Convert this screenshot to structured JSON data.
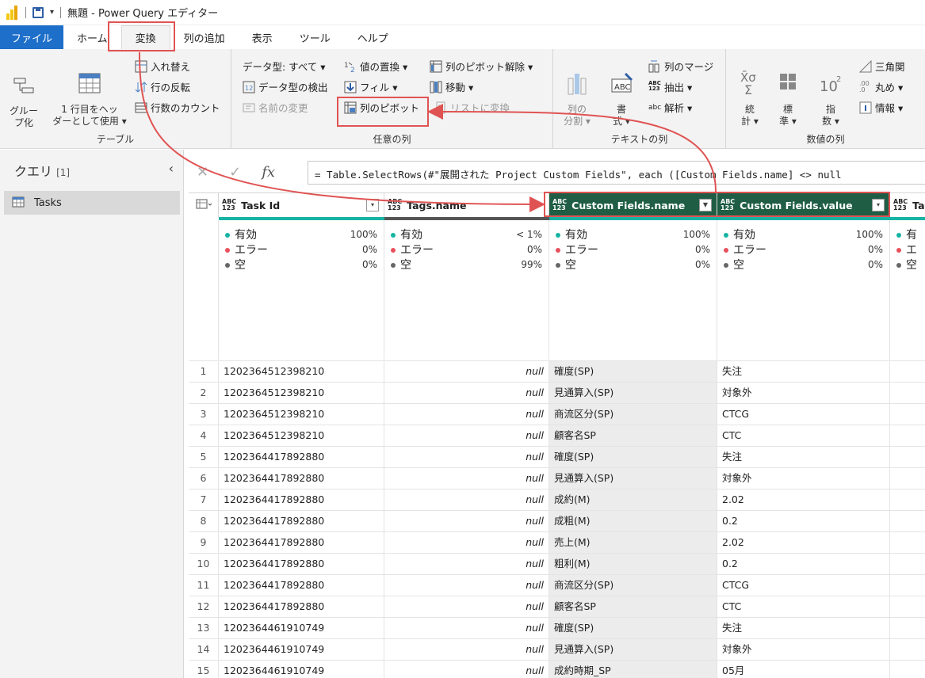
{
  "titlebar": {
    "qa_dropdown": "▾",
    "title": "無題 - Power Query エディター"
  },
  "tabs": [
    "ファイル",
    "ホーム",
    "変換",
    "列の追加",
    "表示",
    "ツール",
    "ヘルプ"
  ],
  "ribbon": {
    "table_group": {
      "label": "テーブル",
      "group_by": "グルー\nプ化",
      "first_row": "1 行目をヘッ\nダーとして使用 ▾",
      "transpose": "入れ替え",
      "reverse_rows": "行の反転",
      "count_rows": "行数のカウント"
    },
    "any_column_group": {
      "label": "任意の列",
      "data_type": "データ型: すべて ▾",
      "detect_type": "データ型の検出",
      "rename": "名前の変更",
      "replace_values": "値の置換 ▾",
      "fill": "フィル ▾",
      "pivot": "列のピボット",
      "unpivot": "列のピボット解除 ▾",
      "move": "移動 ▾",
      "to_list": "リストに変換"
    },
    "text_group": {
      "label": "テキストの列",
      "split": "列の\n分割 ▾",
      "format": "書\n式 ▾",
      "merge": "列のマージ",
      "extract": "抽出 ▾",
      "parse": "解析 ▾"
    },
    "number_group": {
      "label": "数値の列",
      "stats": "統\n計 ▾",
      "standard": "標\n準 ▾",
      "scientific": "指\n数 ▾",
      "trig": "三角関",
      "rounding": "丸め ▾",
      "info": "情報 ▾"
    }
  },
  "queries": {
    "title": "クエリ",
    "count": "[1]",
    "items": [
      "Tasks"
    ]
  },
  "formula": {
    "text": "= Table.SelectRows(#\"展開された Project Custom Fields\", each ([Custom Fields.name] <> null"
  },
  "columns": [
    {
      "name": "Task Id",
      "valid": "100%",
      "error": "0%",
      "empty": "0%"
    },
    {
      "name": "Tags.name",
      "valid": "< 1%",
      "error": "0%",
      "empty": "99%"
    },
    {
      "name": "Custom Fields.name",
      "valid": "100%",
      "error": "0%",
      "empty": "0%"
    },
    {
      "name": "Custom Fields.value",
      "valid": "100%",
      "error": "0%",
      "empty": "0%"
    },
    {
      "name": "Ta"
    }
  ],
  "profile_labels": {
    "valid": "有効",
    "error": "エラー",
    "empty": "空",
    "valid_short": "有",
    "error_short": "エ",
    "empty_short": "空"
  },
  "type_icon": {
    "top": "ABC",
    "bottom": "123"
  },
  "rows": [
    {
      "n": "1",
      "id": "1202364512398210",
      "tag": "null",
      "name": "確度(SP)",
      "value": "失注"
    },
    {
      "n": "2",
      "id": "1202364512398210",
      "tag": "null",
      "name": "見通算入(SP)",
      "value": "対象外"
    },
    {
      "n": "3",
      "id": "1202364512398210",
      "tag": "null",
      "name": "商流区分(SP)",
      "value": "CTCG"
    },
    {
      "n": "4",
      "id": "1202364512398210",
      "tag": "null",
      "name": "顧客名SP",
      "value": "CTC"
    },
    {
      "n": "5",
      "id": "1202364417892880",
      "tag": "null",
      "name": "確度(SP)",
      "value": "失注"
    },
    {
      "n": "6",
      "id": "1202364417892880",
      "tag": "null",
      "name": "見通算入(SP)",
      "value": "対象外"
    },
    {
      "n": "7",
      "id": "1202364417892880",
      "tag": "null",
      "name": "成約(M)",
      "value": "2.02"
    },
    {
      "n": "8",
      "id": "1202364417892880",
      "tag": "null",
      "name": "成粗(M)",
      "value": "0.2"
    },
    {
      "n": "9",
      "id": "1202364417892880",
      "tag": "null",
      "name": "売上(M)",
      "value": "2.02"
    },
    {
      "n": "10",
      "id": "1202364417892880",
      "tag": "null",
      "name": "粗利(M)",
      "value": "0.2"
    },
    {
      "n": "11",
      "id": "1202364417892880",
      "tag": "null",
      "name": "商流区分(SP)",
      "value": "CTCG"
    },
    {
      "n": "12",
      "id": "1202364417892880",
      "tag": "null",
      "name": "顧客名SP",
      "value": "CTC"
    },
    {
      "n": "13",
      "id": "1202364461910749",
      "tag": "null",
      "name": "確度(SP)",
      "value": "失注"
    },
    {
      "n": "14",
      "id": "1202364461910749",
      "tag": "null",
      "name": "見通算入(SP)",
      "value": "対象外"
    },
    {
      "n": "15",
      "id": "1202364461910749",
      "tag": "null",
      "name": "成約時期_SP",
      "value": "05月"
    }
  ],
  "colors": {
    "accent": "#1e6fc9",
    "selected_header": "#1f5e44",
    "highlight": "#e05353",
    "valid": "#17b3a3",
    "error": "#e8505b",
    "empty": "#666666"
  }
}
